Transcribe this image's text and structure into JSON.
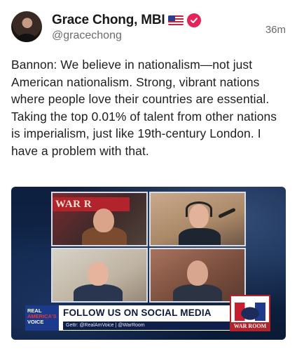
{
  "author": {
    "display_name": "Grace Chong, MBI",
    "handle": "@gracechong",
    "flag_icon": "us-flag-emoji",
    "verified_icon": "verified-badge",
    "verified_color": "#e3245a"
  },
  "post": {
    "timestamp": "36m",
    "text": "Bannon: We believe in nationalism—not just American nationalism. Strong, vibrant nations where people love their countries are essential. Taking the top 0.01% of talent from other nations is imperialism, just like 19th-century London. I have a problem with that."
  },
  "video": {
    "sign_text": "WAR R",
    "banner": {
      "logo_line1": "REAL",
      "logo_line2": "AMERICA'S",
      "logo_line3": "VOICE",
      "title": "FOLLOW US ON SOCIAL MEDIA",
      "subtitle": "Gettr: @RealAmVoice | @WarRoom"
    },
    "corner_logo_text": "WAR ROOM"
  }
}
